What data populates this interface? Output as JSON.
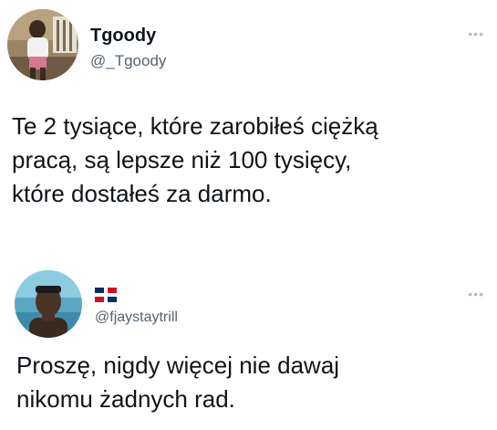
{
  "tweets": [
    {
      "author": {
        "display_name": "Tgoody",
        "handle": "@_Tgoody",
        "avatar_icon": "user-avatar-photo"
      },
      "more_icon": "more-options-icon",
      "text_lines": [
        "Te 2 tysiące, które zarobiłeś ciężką",
        "pracą, są lepsze niż 100 tysięcy,",
        "które dostałeś za darmo."
      ]
    },
    {
      "author": {
        "display_name_flag": "dominican-republic-flag-icon",
        "handle": "@fjaystaytrill",
        "avatar_icon": "user-avatar-photo"
      },
      "more_icon": "more-options-icon",
      "text_lines": [
        "Proszę, nigdy więcej nie dawaj",
        "nikomu żadnych rad."
      ]
    }
  ],
  "colors": {
    "text": "#0f1419",
    "secondary_text": "#536471",
    "background": "#ffffff"
  }
}
